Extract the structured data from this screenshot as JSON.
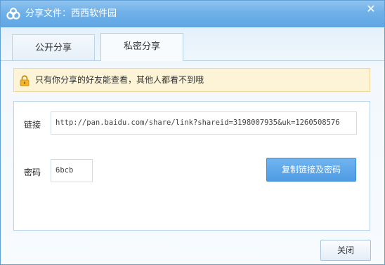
{
  "window": {
    "title": "分享文件：西西软件园",
    "close_glyph": "✕"
  },
  "tabs": [
    {
      "label": "公开分享",
      "active": false
    },
    {
      "label": "私密分享",
      "active": true
    }
  ],
  "notice": {
    "text": "只有你分享的好友能查看，其他人都看不到哦"
  },
  "form": {
    "link_label": "链接",
    "link_value": "http://pan.baidu.com/share/link?shareid=3198007935&uk=1260508576",
    "password_label": "密码",
    "password_value": "6bcb",
    "copy_button": "复制链接及密码"
  },
  "footer": {
    "close_button": "关闭"
  },
  "colors": {
    "titlebar": "#6fb0e8",
    "primary_button": "#4e9be4",
    "notice_bg": "#fdf4d8"
  }
}
